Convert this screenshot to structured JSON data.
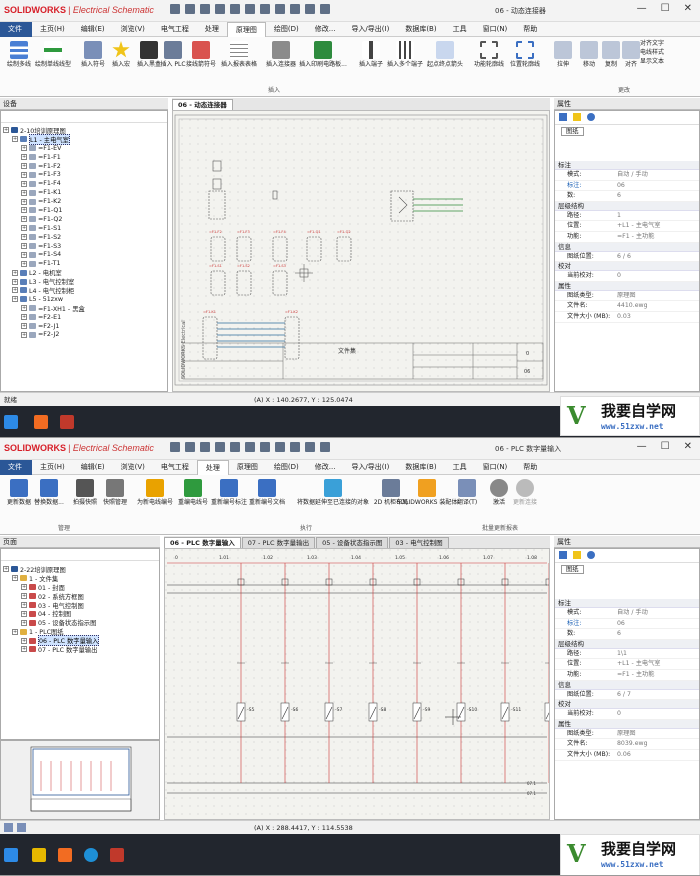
{
  "app": {
    "brand": "SOLIDWORKS",
    "product": "Electrical Schematic"
  },
  "top": {
    "title": "06 - 动态连接器",
    "menus": [
      "文件(F)",
      "主页(H)",
      "编辑(E)",
      "浏览(V)",
      "电气工程",
      "处理",
      "原理图",
      "绘图(D)",
      "修改...",
      "导入/导出(I)",
      "数据库(B)",
      "工具",
      "窗口(N)",
      "帮助"
    ],
    "ribbon_buttons": [
      "绘制多线",
      "绘制单线线型",
      "插入符号",
      "插入宏",
      "插入黑盒",
      "插入 PLC",
      "接线箭符号",
      "插入报表表格",
      "插入连接器",
      "插入印刷电路板...",
      "插入端子",
      "插入多个端子",
      "起点终点箭头",
      "功能轮廓线",
      "位置轮廓线",
      "拉伸",
      "移动",
      "复制",
      "对齐"
    ],
    "right_col": [
      "对齐文字",
      "电线样式",
      "显示文本"
    ],
    "group_insert": "插入",
    "group_modify": "更改",
    "devices_title": "设备",
    "tree": [
      "2-10培训原理图",
      "L1 - 主电气室",
      "=F1-EV",
      "=F1-F1",
      "=F1-F2",
      "=F1-F3",
      "=F1-F4",
      "=F1-K1",
      "=F1-K2",
      "=F1-Q1",
      "=F1-Q2",
      "=F1-S1",
      "=F1-S2",
      "=F1-S3",
      "=F1-S4",
      "=F1-T1",
      "L2 - 电机室",
      "L3 - 电气控制室",
      "L4 - 电气控制柜",
      "L5 - 51zxw",
      "=F1-XH1 - 黑盒",
      "=F2-E1",
      "=F2-J1",
      "=F2-J2"
    ],
    "tab": "06 - 动态连接器",
    "props_title": "属性",
    "props_tab": "图纸",
    "props": [
      {
        "section": "标注"
      },
      {
        "k": "模式:",
        "v": "自动 / 手动"
      },
      {
        "k": "标注:",
        "v": "06"
      },
      {
        "k": "数:",
        "v": "6"
      },
      {
        "section": "层级结构"
      },
      {
        "k": "路径:",
        "v": "1"
      },
      {
        "k": "位置:",
        "v": "+L1 - 主电气室"
      },
      {
        "k": "功能:",
        "v": "=F1 - 主功能"
      },
      {
        "section": "信息"
      },
      {
        "k": "图纸位置:",
        "v": "6 / 6"
      },
      {
        "section": "校对"
      },
      {
        "k": "当前校对:",
        "v": "0"
      },
      {
        "section": "属性"
      },
      {
        "k": "图纸类型:",
        "v": "原理图"
      },
      {
        "k": "文件名:",
        "v": "4410.ewg"
      },
      {
        "k": "文件大小 (MB):",
        "v": "0.03"
      }
    ],
    "titleblock": {
      "name": "文件集",
      "page": "06",
      "rev": "0",
      "vlabel": "SOLIDWORKS Electrical"
    },
    "status_ready": "就绪",
    "coord": "(A) X : 140.2677, Y : 125.0474"
  },
  "bottom": {
    "title": "06 - PLC 数字量输入",
    "menus": [
      "文件(F)",
      "主页(H)",
      "编辑(E)",
      "浏览(V)",
      "电气工程",
      "处理",
      "原理图",
      "绘图(D)",
      "修改...",
      "导入/导出(I)",
      "数据库(B)",
      "工具",
      "窗口(N)",
      "帮助"
    ],
    "ribbon_buttons": [
      "更新数据",
      "替换数据...",
      "拍摄快照",
      "快照管理",
      "为新电线编号",
      "重编电线号",
      "重新编号标注",
      "重新编号文档",
      "将数据延伸至已连接的对象",
      "2D 机柜布局",
      "SOLIDWORKS 装配体",
      "翻译(T)",
      "激活",
      "更新连接"
    ],
    "groups": [
      "管理",
      "执行",
      "批量更新报表"
    ],
    "pages_title": "页面",
    "tree": [
      "2-22培训原理图",
      "1 - 文件集",
      "01 - 封面",
      "02 - 系统方框图",
      "03 - 电气控制图",
      "04 - 控制图",
      "05 - 设备状态指示图",
      "1 - PLC图纸",
      "06 - PLC 数字量输入",
      "07 - PLC 数字量输出"
    ],
    "tabs": [
      "06 - PLC 数字量输入",
      "07 - PLC 数字量输出",
      "05 - 设备状态指示图",
      "03 - 电气控制图"
    ],
    "props_title": "属性",
    "props_tab": "图纸",
    "props": [
      {
        "section": "标注"
      },
      {
        "k": "模式:",
        "v": "自动 / 手动"
      },
      {
        "k": "标注:",
        "v": "06"
      },
      {
        "k": "数:",
        "v": "6"
      },
      {
        "section": "层级结构"
      },
      {
        "k": "路径:",
        "v": "1\\1"
      },
      {
        "k": "位置:",
        "v": "+L1 - 主电气室"
      },
      {
        "k": "功能:",
        "v": "=F1 - 主功能"
      },
      {
        "section": "信息"
      },
      {
        "k": "图纸位置:",
        "v": "6 / 7"
      },
      {
        "section": "校对"
      },
      {
        "k": "当前校对:",
        "v": "0"
      },
      {
        "section": "属性"
      },
      {
        "k": "图纸类型:",
        "v": "原理图"
      },
      {
        "k": "文件名:",
        "v": "8039.ewg"
      },
      {
        "k": "文件大小 (MB):",
        "v": "0.06"
      }
    ],
    "columns": [
      "0",
      "1.01",
      "1.02",
      "1.03",
      "1.04",
      "1.05",
      "1.06",
      "1.07",
      "1.08"
    ],
    "switches": [
      "-S5",
      "-S6",
      "-S7",
      "-S8",
      "-S9",
      "-S10",
      "-S11",
      "-S12",
      "-S13"
    ],
    "coord": "(A) X : 288.4417, Y : 114.5538"
  },
  "watermark": {
    "text": "我要自学网",
    "url": "www.51zxw.net"
  }
}
